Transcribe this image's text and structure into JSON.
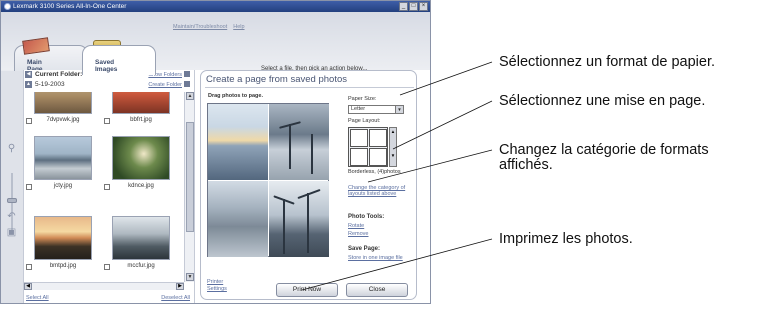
{
  "window": {
    "title": "Lexmark 3100 Series All-In-One Center",
    "controls": [
      "_",
      "□",
      "×"
    ],
    "top_links": [
      "Maintain/Troubleshoot",
      "Help"
    ]
  },
  "tabs": [
    {
      "label_line1": "Main",
      "label_line2": "Page"
    },
    {
      "label_line1": "Saved",
      "label_line2": "Images"
    }
  ],
  "instruction": "Select a file, then pick an action below...",
  "folder": {
    "label": "Current Folder:",
    "name": "5-19-2003",
    "show_folders": "Show Folders",
    "create_folder": "Create Folder"
  },
  "thumbnails": [
    {
      "filename": "7dvpvwk.jpg"
    },
    {
      "filename": "bbfrt.jpg"
    },
    {
      "filename": "jcty.jpg"
    },
    {
      "filename": "kdnce.jpg"
    },
    {
      "filename": "bmtpd.jpg"
    },
    {
      "filename": "mccfur.jpg"
    }
  ],
  "footer": {
    "select_all": "Select All",
    "deselect_all": "Deselect All"
  },
  "card": {
    "title": "Create a page from saved photos",
    "drag_label": "Drag photos to page.",
    "paper_size_label": "Paper Size:",
    "paper_size_value": "Letter",
    "page_layout_label": "Page Layout:",
    "layout_caption": "Borderless, (4)photos",
    "change_category_link_line1": "Change the category of",
    "change_category_link_line2": "layouts listed above",
    "photo_tools_label": "Photo Tools:",
    "rotate_link": "Rotate",
    "remove_link": "Remove",
    "save_page_label": "Save Page:",
    "store_link": "Store in one image file",
    "printer_settings_line1": "Printer",
    "printer_settings_line2": "Settings",
    "print_now": "Print Now",
    "close": "Close"
  },
  "callouts": {
    "paper_format": "Sélectionnez un format de papier.",
    "layout": "Sélectionnez une mise en page.",
    "category_line1": "Changez la catégorie de formats",
    "category_line2": "affichés.",
    "print": "Imprimez les photos."
  },
  "colors": {
    "title_bar": "#23407f",
    "link": "#5b6fa0",
    "card_title": "#4a5674"
  }
}
